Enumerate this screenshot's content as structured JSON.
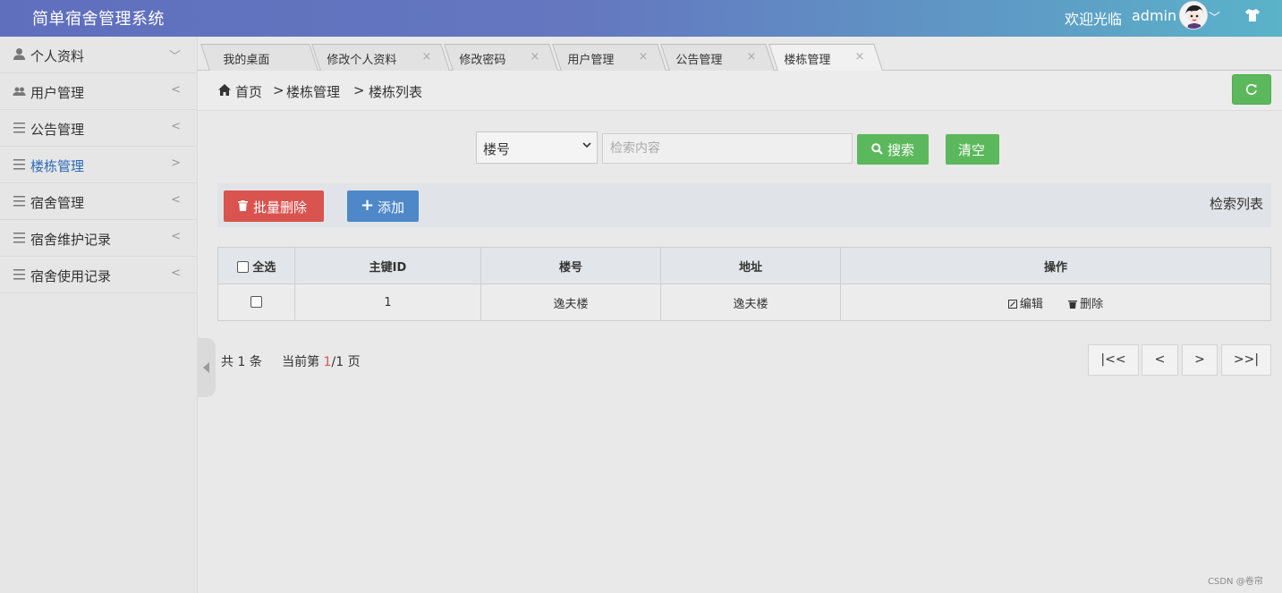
{
  "header": {
    "title": "简单宿舍管理系统",
    "welcome": "欢迎光临",
    "username": "admin",
    "user_menu_chevron": "﹀",
    "icons": [
      "avatar",
      "shirt-icon"
    ]
  },
  "sidebar": {
    "items": [
      {
        "label": "个人资料",
        "arrow": "﹀",
        "icon": "user-icon"
      },
      {
        "label": "用户管理",
        "arrow": "<",
        "icon": "users-icon"
      },
      {
        "label": "公告管理",
        "arrow": "<",
        "icon": "list-icon"
      },
      {
        "label": "楼栋管理",
        "arrow": ">",
        "icon": "list-icon",
        "active": true
      },
      {
        "label": "宿舍管理",
        "arrow": "<",
        "icon": "list-icon"
      },
      {
        "label": "宿舍维护记录",
        "arrow": "<",
        "icon": "list-icon"
      },
      {
        "label": "宿舍使用记录",
        "arrow": "<",
        "icon": "list-icon"
      }
    ]
  },
  "tabs": [
    {
      "label": "我的桌面",
      "close": ""
    },
    {
      "label": "修改个人资料",
      "close": "×"
    },
    {
      "label": "修改密码",
      "close": "×"
    },
    {
      "label": "用户管理",
      "close": "×"
    },
    {
      "label": "公告管理",
      "close": "×"
    },
    {
      "label": "楼栋管理",
      "close": "×",
      "active": true
    }
  ],
  "breadcrumb": {
    "home": "首页",
    "sep": ">",
    "section": "楼栋管理",
    "page": "楼栋列表"
  },
  "search": {
    "field_selected": "楼号",
    "placeholder": "检索内容",
    "search_label": "搜索",
    "clear_label": "清空"
  },
  "toolbar": {
    "batch_delete_label": "批量删除",
    "add_label": "添加",
    "list_title": "检索列表"
  },
  "table": {
    "headers": {
      "select_all": "全选",
      "id": "主键ID",
      "building_no": "楼号",
      "address": "地址",
      "actions": "操作"
    },
    "rows": [
      {
        "id": "1",
        "building_no": "逸夫楼",
        "address": "逸夫楼",
        "edit": "编辑",
        "delete": "删除"
      }
    ]
  },
  "pager": {
    "total_prefix": "共",
    "total": "1",
    "total_suffix": "条",
    "current_prefix": "当前第",
    "current": "1",
    "slash": "/",
    "pages": "1",
    "pages_suffix": "页",
    "first": "|<<",
    "prev": "<",
    "next": ">",
    "last": ">>|"
  },
  "watermark": "CSDN @卷帘",
  "colors": {
    "success": "#5cb85c",
    "danger": "#d9534f",
    "primary": "#4e88c9",
    "active_nav": "#2b6ab8"
  }
}
